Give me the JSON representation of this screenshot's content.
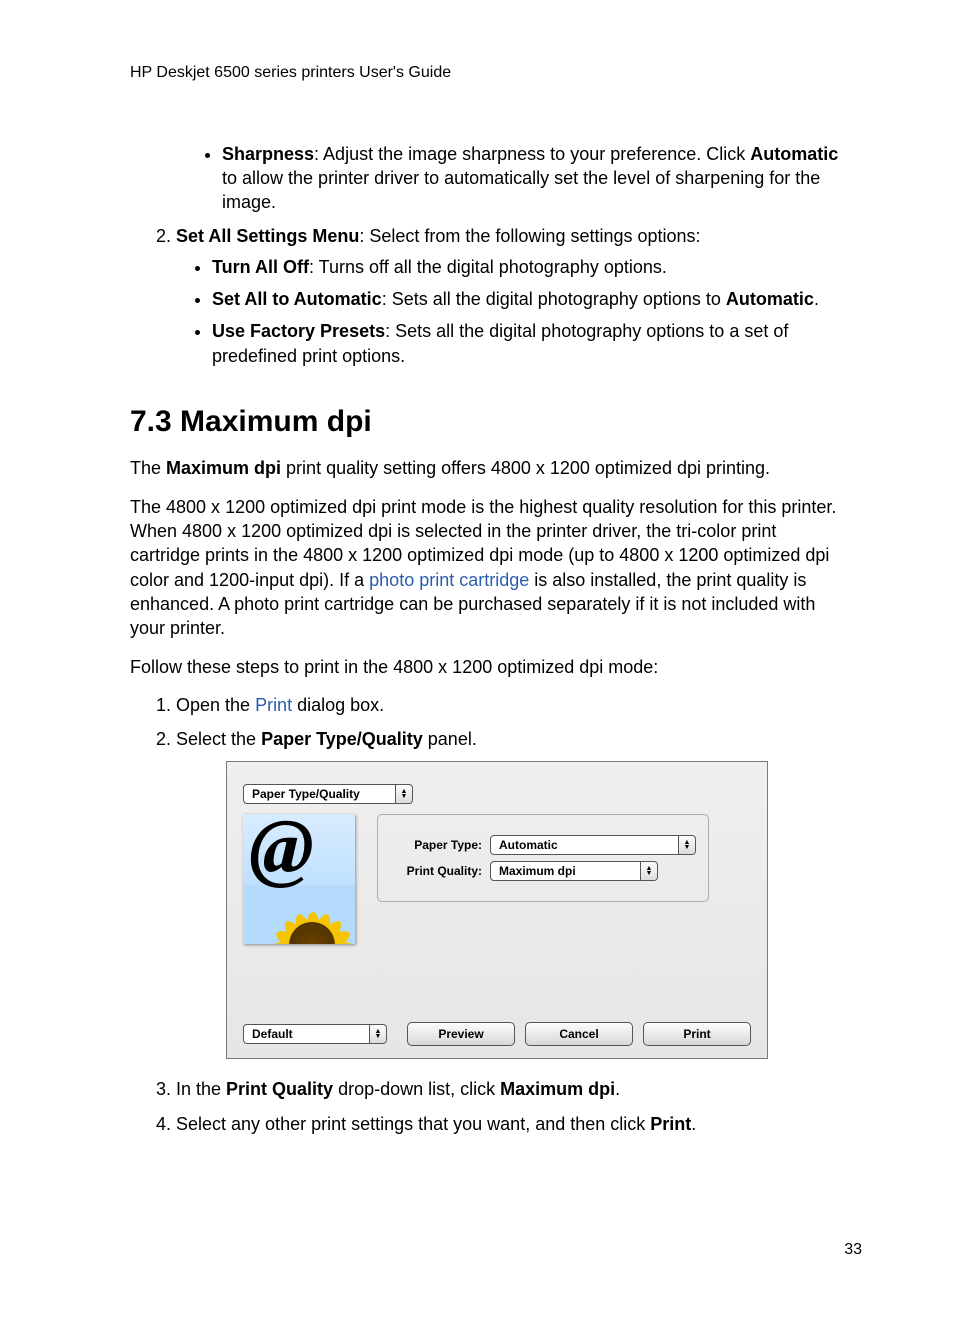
{
  "running_head": "HP Deskjet 6500 series printers User's Guide",
  "page_number": "33",
  "intro_nested_bullet": {
    "label": "Sharpness",
    "rest": ": Adjust the image sharpness to your preference. Click ",
    "label2": "Automatic",
    "rest2": " to allow the printer driver to automatically set the level of sharpening for the image."
  },
  "step2": {
    "label": "Set All Settings Menu",
    "rest": ": Select from the following settings options:",
    "bullets": [
      {
        "label": "Turn All Off",
        "rest": ": Turns off all the digital photography options."
      },
      {
        "label": "Set All to Automatic",
        "rest": ": Sets all the digital photography options to ",
        "tail_bold": "Automatic",
        "tail_rest": "."
      },
      {
        "label": "Use Factory Presets",
        "rest": ": Sets all the digital photography options to a set of predefined print options."
      }
    ]
  },
  "section_heading": "7.3  Maximum dpi",
  "para_a_pre": "The ",
  "para_a_bold": "Maximum dpi",
  "para_a_post": " print quality setting offers 4800 x 1200 optimized dpi printing.",
  "para_b_pre": "The 4800 x 1200 optimized dpi print mode is the highest quality resolution for this printer. When 4800 x 1200 optimized dpi is selected in the printer driver, the tri-color print cartridge prints in the 4800 x 1200 optimized dpi mode (up to 4800 x 1200 optimized dpi color and 1200-input dpi). If a ",
  "para_b_link": "photo print cartridge",
  "para_b_post": " is also installed, the print quality is enhanced. A photo print cartridge can be purchased separately if it is not included with your printer.",
  "para_c": "Follow these steps to print in the 4800 x 1200 optimized dpi mode:",
  "steps2": {
    "s1_pre": "Open the ",
    "s1_link": "Print",
    "s1_post": " dialog box.",
    "s2_pre": "Select the ",
    "s2_bold": "Paper Type/Quality",
    "s2_post": " panel.",
    "s3_pre": "In the ",
    "s3_bold1": "Print Quality",
    "s3_mid": " drop-down list, click ",
    "s3_bold2": "Maximum dpi",
    "s3_post": ".",
    "s4_pre": "Select any other print settings that you want, and then click ",
    "s4_bold": "Print",
    "s4_post": "."
  },
  "dialog": {
    "panel_select": "Paper Type/Quality",
    "paper_type_label": "Paper Type:",
    "paper_type_value": "Automatic",
    "print_quality_label": "Print Quality:",
    "print_quality_value": "Maximum dpi",
    "preset_value": "Default",
    "preview_btn": "Preview",
    "cancel_btn": "Cancel",
    "print_btn": "Print"
  }
}
